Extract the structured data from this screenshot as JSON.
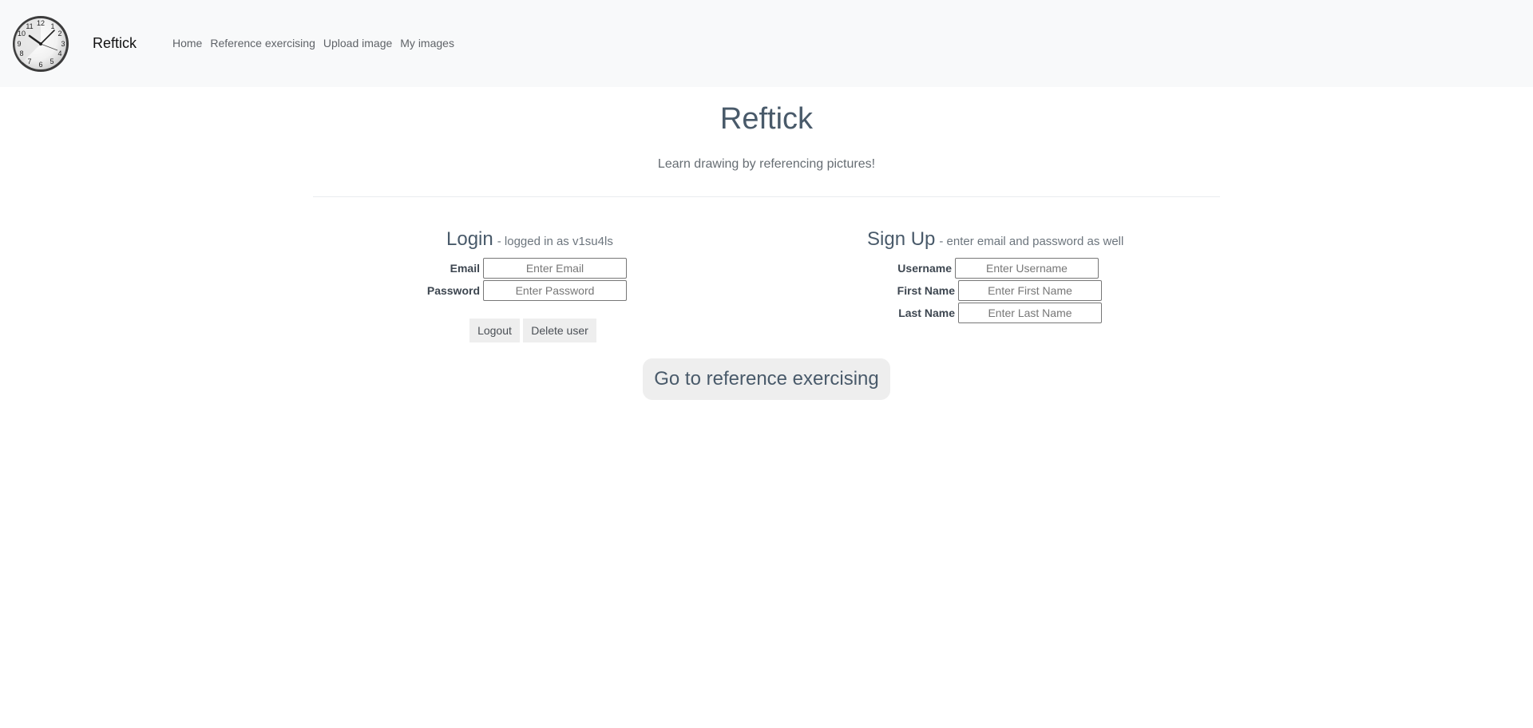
{
  "nav": {
    "logo_icon": "clock-icon",
    "brand": "Reftick",
    "links": [
      "Home",
      "Reference exercising",
      "Upload image",
      "My images"
    ]
  },
  "hero": {
    "title": "Reftick",
    "subtitle": "Learn drawing by referencing pictures!"
  },
  "login": {
    "title": "Login",
    "status": "- logged in as v1su4ls",
    "email_label": "Email",
    "email_placeholder": "Enter Email",
    "password_label": "Password",
    "password_placeholder": "Enter Password",
    "logout_label": "Logout",
    "delete_label": "Delete user"
  },
  "signup": {
    "title": "Sign Up",
    "hint": "- enter email and password as well",
    "username_label": "Username",
    "username_placeholder": "Enter Username",
    "firstname_label": "First Name",
    "firstname_placeholder": "Enter First Name",
    "lastname_label": "Last Name",
    "lastname_placeholder": "Enter Last Name"
  },
  "cta": {
    "label": "Go to reference exercising"
  },
  "colors": {
    "navbar_bg": "#f8f9fa",
    "button_bg": "#eeeeee",
    "title_text": "#495a6a"
  }
}
